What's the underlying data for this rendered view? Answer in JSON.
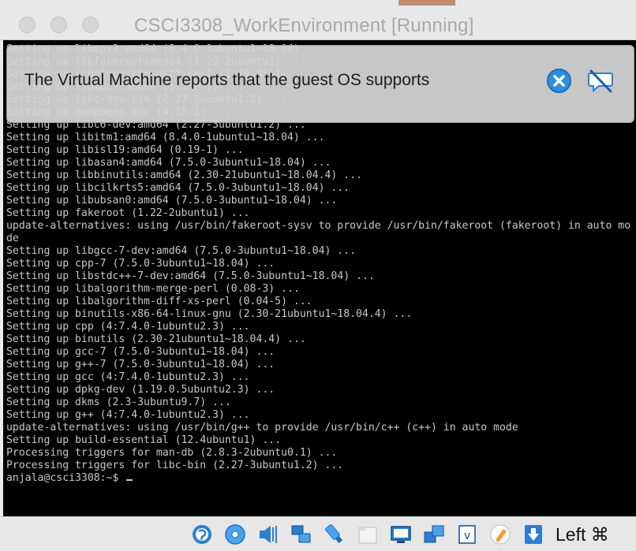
{
  "window": {
    "title": "CSCI3308_WorkEnvironment [Running]"
  },
  "notification": {
    "message": "The Virtual Machine reports that the guest OS supports",
    "close_icon": "close-icon",
    "suppress_icon": "no-message-icon"
  },
  "terminal": {
    "lines": [
      "Setting up libmpx2:amd64 (8.4.0-1ubuntu1~18.04) ...",
      "Setting up libfakeroot:amd64 (1.22-2ubuntu1) ...",
      "Setting up libalgorithm-diff-perl (1.19.03-1) ...",
      "Setting up libmpc3:amd64 (1.1.0-1) ...",
      "Setting up libc-dev-bin (2.27-3ubuntu1.2) ...",
      "Setting up manpages-dev (4.15-1) ...",
      "Setting up libc6-dev:amd64 (2.27-3ubuntu1.2) ...",
      "Setting up libitm1:amd64 (8.4.0-1ubuntu1~18.04) ...",
      "Setting up libisl19:amd64 (0.19-1) ...",
      "Setting up libasan4:amd64 (7.5.0-3ubuntu1~18.04) ...",
      "Setting up libbinutils:amd64 (2.30-21ubuntu1~18.04.4) ...",
      "Setting up libcilkrts5:amd64 (7.5.0-3ubuntu1~18.04) ...",
      "Setting up libubsan0:amd64 (7.5.0-3ubuntu1~18.04) ...",
      "Setting up fakeroot (1.22-2ubuntu1) ...",
      "update-alternatives: using /usr/bin/fakeroot-sysv to provide /usr/bin/fakeroot (fakeroot) in auto mo",
      "de",
      "Setting up libgcc-7-dev:amd64 (7.5.0-3ubuntu1~18.04) ...",
      "Setting up cpp-7 (7.5.0-3ubuntu1~18.04) ...",
      "Setting up libstdc++-7-dev:amd64 (7.5.0-3ubuntu1~18.04) ...",
      "Setting up libalgorithm-merge-perl (0.08-3) ...",
      "Setting up libalgorithm-diff-xs-perl (0.04-5) ...",
      "Setting up binutils-x86-64-linux-gnu (2.30-21ubuntu1~18.04.4) ...",
      "Setting up cpp (4:7.4.0-1ubuntu2.3) ...",
      "Setting up binutils (2.30-21ubuntu1~18.04.4) ...",
      "Setting up gcc-7 (7.5.0-3ubuntu1~18.04) ...",
      "Setting up g++-7 (7.5.0-3ubuntu1~18.04) ...",
      "Setting up gcc (4:7.4.0-1ubuntu2.3) ...",
      "Setting up dpkg-dev (1.19.0.5ubuntu2.3) ...",
      "Setting up dkms (2.3-3ubuntu9.7) ...",
      "Setting up g++ (4:7.4.0-1ubuntu2.3) ...",
      "update-alternatives: using /usr/bin/g++ to provide /usr/bin/c++ (c++) in auto mode",
      "Setting up build-essential (12.4ubuntu1) ...",
      "Processing triggers for man-db (2.8.3-2ubuntu0.1) ...",
      "Processing triggers for libc-bin (2.27-3ubuntu1.2) ..."
    ],
    "prompt": "anjala@csci3308:~$ "
  },
  "statusbar": {
    "icons": [
      "hard-disk-icon",
      "optical-drive-icon",
      "audio-icon",
      "network-icon",
      "usb-icon",
      "shared-folders-icon",
      "display-icon",
      "video-capture-icon",
      "recording-icon",
      "cpu-icon",
      "mouse-integration-icon",
      "keyboard-capture-icon"
    ],
    "host_key": "Left ⌘"
  },
  "colors": {
    "terminal_bg": "#000000",
    "terminal_fg": "#c9c9c9",
    "accent_blue": "#2d8fe0"
  }
}
